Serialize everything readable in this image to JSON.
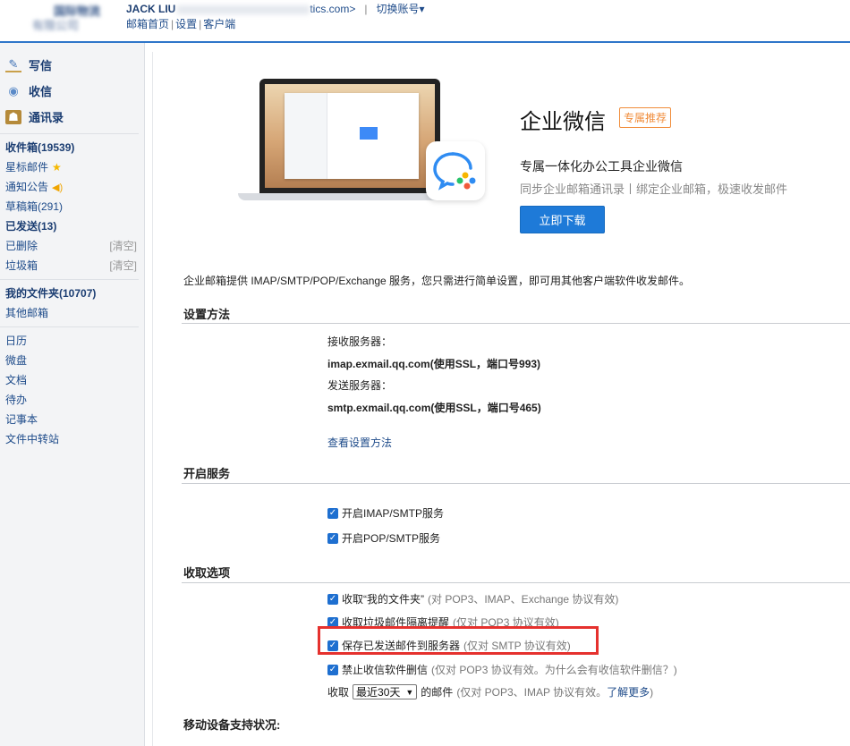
{
  "header": {
    "logo_line1": "国际物流",
    "logo_line2": "有限公司",
    "account_name": "JACK LIU",
    "account_email_tail": "tics.com>",
    "switch_label": "切换账号▾",
    "links": [
      "邮箱首页",
      "设置",
      "客户端"
    ]
  },
  "sidebar": {
    "main_actions": [
      {
        "label": "写信",
        "icon": "compose-icon"
      },
      {
        "label": "收信",
        "icon": "inbox-icon"
      },
      {
        "label": "通讯录",
        "icon": "contacts-icon"
      }
    ],
    "folders": [
      {
        "label": "收件箱(19539)",
        "bold": true
      },
      {
        "label": "星标邮件",
        "extra": "star"
      },
      {
        "label": "通知公告",
        "extra": "speaker"
      },
      {
        "label": "草稿箱(291)"
      },
      {
        "label": "已发送(13)",
        "bold": true
      },
      {
        "label": "已删除",
        "clean": "[清空]"
      },
      {
        "label": "垃圾箱",
        "clean": "[清空]"
      }
    ],
    "my_folders": [
      {
        "label": "我的文件夹(10707)",
        "bold": true
      },
      {
        "label": "其他邮箱"
      }
    ],
    "apps": [
      "日历",
      "微盘",
      "文档",
      "待办",
      "记事本",
      "文件中转站"
    ]
  },
  "promo": {
    "title": "企业微信",
    "badge": "专属推荐",
    "subtitle": "专属一体化办公工具企业微信",
    "desc": "同步企业邮箱通讯录丨绑定企业邮箱，极速收发邮件",
    "button": "立即下载"
  },
  "settings": {
    "intro": "企业邮箱提供 IMAP/SMTP/POP/Exchange 服务，您只需进行简单设置，即可用其他客户端软件收发邮件。",
    "setup_title": "设置方法",
    "incoming_label": "接收服务器：",
    "incoming_value": "imap.exmail.qq.com(使用SSL，端口号993)",
    "outgoing_label": "发送服务器：",
    "outgoing_value": "smtp.exmail.qq.com(使用SSL，端口号465)",
    "view_method": "查看设置方法",
    "service_title": "开启服务",
    "imap_service": "开启IMAP/SMTP服务",
    "pop_service": "开启POP/SMTP服务",
    "fetch_title": "收取选项",
    "opt1_label": "收取“我的文件夹”",
    "opt1_note": "(对 POP3、IMAP、Exchange 协议有效)",
    "opt2_label": "收取垃圾邮件隔离提醒",
    "opt2_note": "(仅对 POP3 协议有效)",
    "opt3_label": "保存已发送邮件到服务器",
    "opt3_note": "(仅对 SMTP 协议有效)",
    "opt4_label": "禁止收信软件删信",
    "opt4_note": "(仅对 POP3 协议有效。为什么会有收信软件删信？)",
    "fetch_prefix": "收取",
    "fetch_select": "最近30天",
    "fetch_suffix": "的邮件",
    "fetch_note": "(仅对 POP3、IMAP 协议有效。",
    "fetch_more": "了解更多",
    "fetch_note_end": ")",
    "mobile_title": "移动设备支持状况:"
  },
  "colors": {
    "accent": "#1e7ad8",
    "highlight": "#e5312e",
    "badge": "#f08c3a"
  }
}
